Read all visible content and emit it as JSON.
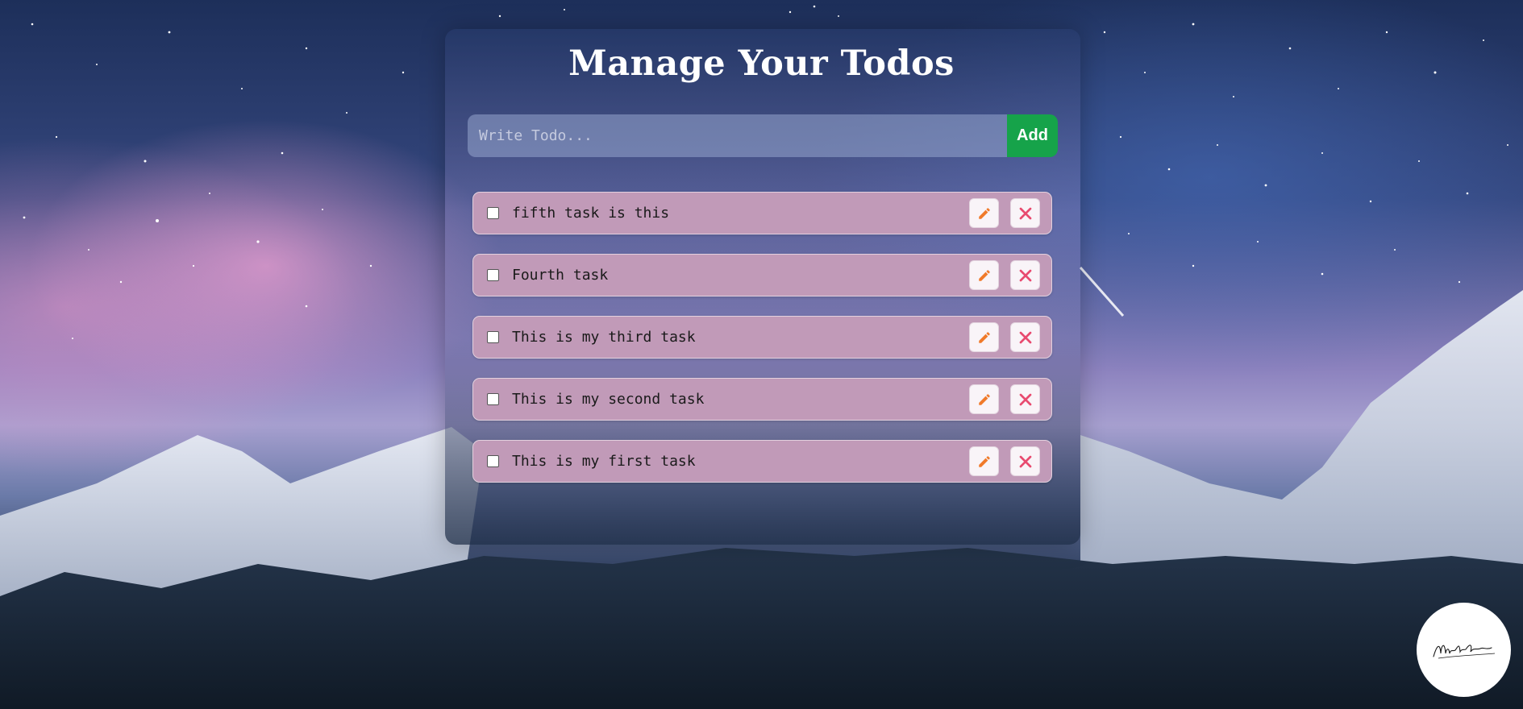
{
  "app": {
    "title": "Manage Your Todos"
  },
  "form": {
    "placeholder": "Write Todo...",
    "value": "",
    "add_label": "Add"
  },
  "todos": [
    {
      "text": "fifth task is this",
      "completed": false
    },
    {
      "text": "Fourth task",
      "completed": false
    },
    {
      "text": "This is my third task",
      "completed": false
    },
    {
      "text": "This is my second task",
      "completed": false
    },
    {
      "text": "This is my first task",
      "completed": false
    }
  ],
  "icons": {
    "edit": "pencil-icon",
    "delete": "close-icon",
    "logo": "signature-logo"
  },
  "colors": {
    "add_button": "#16a34a",
    "todo_background": "#c19ab8",
    "edit_icon": "#f07a2a",
    "delete_icon": "#e84a6f"
  }
}
